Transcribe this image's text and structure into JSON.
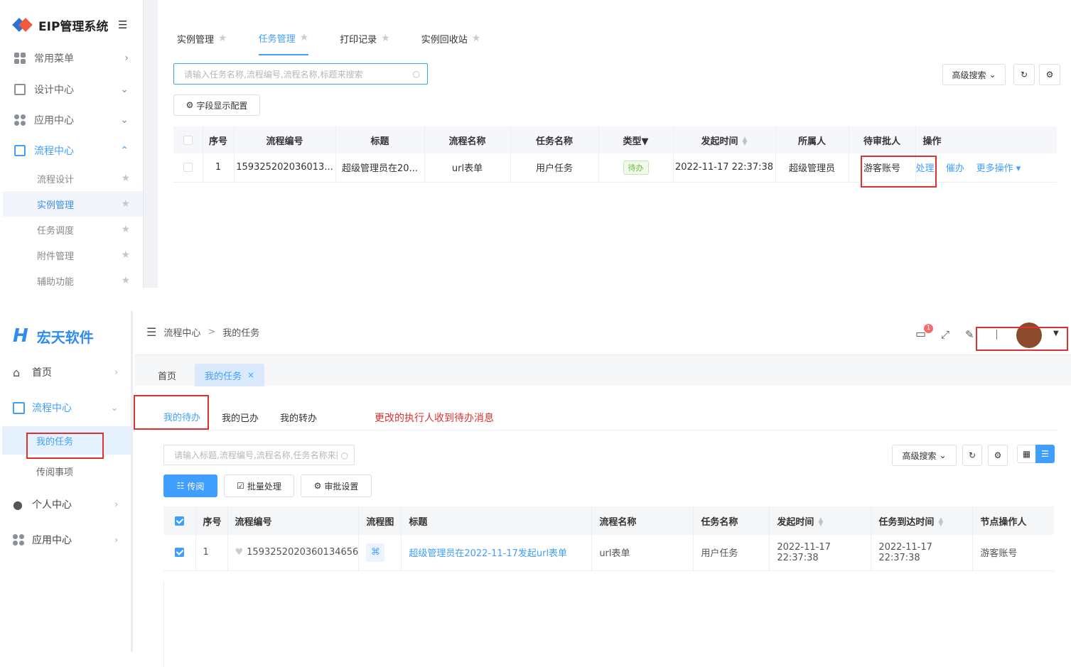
{
  "top": {
    "app_title": "EIP管理系统",
    "menu": [
      {
        "label": "常用菜单",
        "icon": "grid-icon",
        "arrow": "›"
      },
      {
        "label": "设计中心",
        "icon": "design-icon",
        "arrow": "⌄"
      },
      {
        "label": "应用中心",
        "icon": "apps-icon",
        "arrow": "⌄"
      },
      {
        "label": "流程中心",
        "icon": "flow-icon",
        "arrow": "⌃"
      }
    ],
    "submenu": [
      "流程设计",
      "实例管理",
      "任务调度",
      "附件管理",
      "辅助功能"
    ],
    "tabs": [
      "实例管理",
      "任务管理",
      "打印记录",
      "实例回收站"
    ],
    "search_placeholder": "请输入任务名称,流程编号,流程名称,标题来搜索",
    "advanced_search": "高级搜索",
    "field_config": "字段显示配置",
    "columns": [
      "序号",
      "流程编号",
      "标题",
      "流程名称",
      "任务名称",
      "类型",
      "发起时间",
      "所属人",
      "待审批人",
      "操作"
    ],
    "row": {
      "index": "1",
      "flow_no": "159325202036013...",
      "title": "超级管理员在20...",
      "flow_name": "url表单",
      "task_name": "用户任务",
      "type": "待办",
      "start_time": "2022-11-17 22:37:38",
      "owner": "超级管理员",
      "approver": "游客账号",
      "ops": [
        "处理",
        "催办",
        "更多操作"
      ]
    }
  },
  "bottom": {
    "brand": "宏天软件",
    "menu": [
      {
        "label": "首页",
        "icon": "home-icon"
      },
      {
        "label": "流程中心",
        "icon": "flow-icon"
      },
      {
        "label": "个人中心",
        "icon": "user-icon"
      },
      {
        "label": "应用中心",
        "icon": "apps-icon"
      }
    ],
    "submenu": [
      "我的任务",
      "传阅事项"
    ],
    "breadcrumb": [
      "流程中心",
      "我的任务"
    ],
    "breadcrumb_sep": ">",
    "notification_count": "1",
    "page_tabs": [
      "首页",
      "我的任务"
    ],
    "close_mark": "×",
    "sub_tabs": [
      "我的待办",
      "我的已办",
      "我的转办"
    ],
    "annotation": "更改的执行人收到待办消息",
    "search_placeholder": "请输入标题,流程编号,流程名称,任务名称来搜",
    "advanced_search": "高级搜索",
    "buttons": [
      "传阅",
      "批量处理",
      "审批设置"
    ],
    "columns": [
      "序号",
      "流程编号",
      "流程图",
      "标题",
      "流程名称",
      "任务名称",
      "发起时间",
      "任务到达时间",
      "节点操作人"
    ],
    "row": {
      "index": "1",
      "flow_no": "1593252020360134656",
      "title": "超级管理员在2022-11-17发起url表单",
      "flow_name": "url表单",
      "task_name": "用户任务",
      "start_time": "2022-11-17 22:37:38",
      "arrive_time": "2022-11-17 22:37:38",
      "operator": "游客账号"
    }
  },
  "colors": {
    "accent": "#409eff",
    "highlight": "#e03131",
    "brand": "#2f8cf1"
  }
}
